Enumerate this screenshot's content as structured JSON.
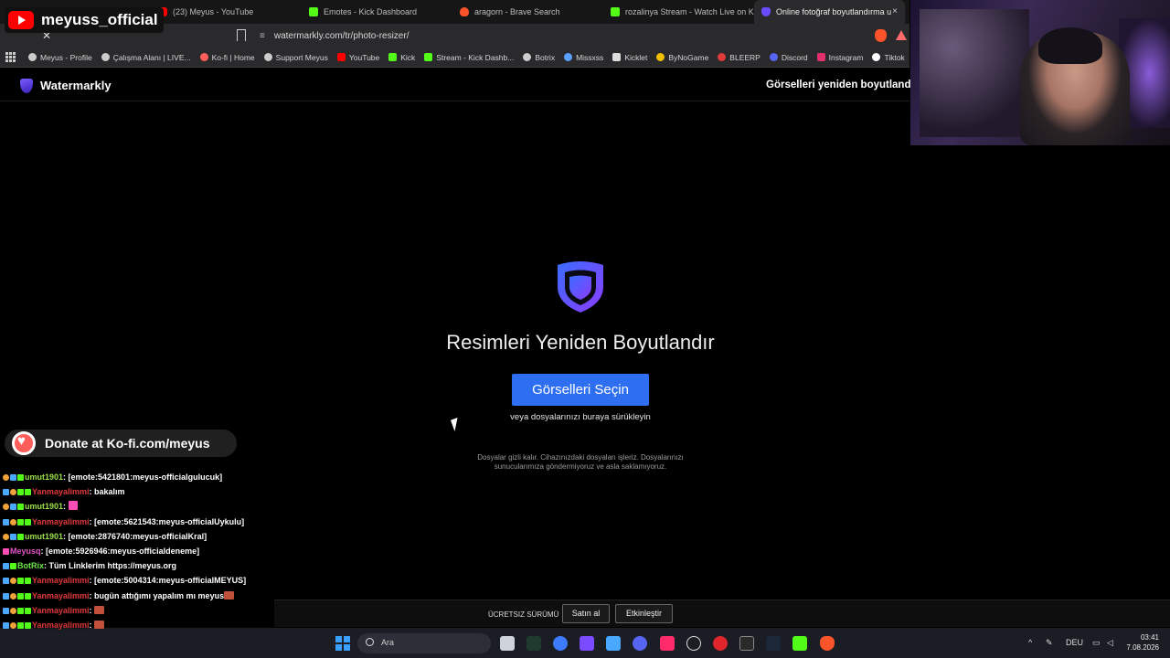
{
  "tabs": [
    {
      "title": "",
      "icon": "kick-icon",
      "active": false
    },
    {
      "title": "(23) Meyus - YouTube",
      "icon": "youtube-icon",
      "active": false
    },
    {
      "title": "Emotes - Kick Dashboard",
      "icon": "kick-icon",
      "active": false
    },
    {
      "title": "aragorn - Brave Search",
      "icon": "brave-icon",
      "active": false
    },
    {
      "title": "rozalinya Stream - Watch Live on Kick",
      "icon": "kick-icon",
      "active": false
    },
    {
      "title": "Online fotoğraf boyutlandırma u",
      "icon": "watermarkly-icon",
      "active": true,
      "close": "×"
    }
  ],
  "address": {
    "url": "watermarkly.com/tr/photo-resizer/",
    "stop": "✕"
  },
  "bookmarks": [
    {
      "label": "Meyus - Profile",
      "color": "#cccccc"
    },
    {
      "label": "Çalışma Alanı | LIVE...",
      "color": "#cccccc"
    },
    {
      "label": "Ko-fi | Home",
      "color": "#ff5e5b"
    },
    {
      "label": "Support Meyus",
      "color": "#cccccc"
    },
    {
      "label": "YouTube",
      "color": "#ff0000"
    },
    {
      "label": "Kick",
      "color": "#53fc18"
    },
    {
      "label": "Stream - Kick Dashb...",
      "color": "#53fc18"
    },
    {
      "label": "Botrix",
      "color": "#cccccc"
    },
    {
      "label": "Missxss",
      "color": "#5aa0ff"
    },
    {
      "label": "Kicklet",
      "color": "#dddddd"
    },
    {
      "label": "ByNoGame",
      "color": "#f0c000"
    },
    {
      "label": "BLEERP",
      "color": "#e03a3a"
    },
    {
      "label": "Discord",
      "color": "#5865f2"
    },
    {
      "label": "Instagram",
      "color": "#e1306c"
    },
    {
      "label": "Tiktok",
      "color": "#ffffff"
    }
  ],
  "site": {
    "logo": "Watermarkly",
    "header_title": "Görselleri yeniden boyutlandır",
    "hero_title": "Resimleri Yeniden Boyutlandır",
    "select_button": "Görselleri Seçin",
    "drop_hint": "veya dosyalarınızı buraya sürükleyin",
    "privacy": "Dosyalar gizli kalır. Cihazınızdaki dosyaları işleriz. Dosyalarınızı sunucularımıza göndermiyoruz ve asla saklamıyoruz."
  },
  "footer": {
    "free_version": "ÜCRETSIZ SÜRÜMÜ",
    "buy": "Satın al",
    "activate": "Etkinleştir"
  },
  "taskbar": {
    "search_placeholder": "Ara",
    "lang": "DEU",
    "time": "03:41",
    "date": "7.08.2026"
  },
  "overlay": {
    "channel": "meyuss_official",
    "kofi": "Donate at Ko-fi.com/meyus",
    "chat": [
      {
        "user": "umut1901",
        "sep": ": ",
        "msg": "[emote:5421801:meyus-officialgulucuk]",
        "color": "lime"
      },
      {
        "user": "Yanmayalimmi",
        "sep": ": ",
        "msg": "bakalım",
        "color": "red"
      },
      {
        "user": "umut1901",
        "sep": ": ",
        "msg": "",
        "color": "lime"
      },
      {
        "user": "Yanmayalimmi",
        "sep": ": ",
        "msg": "[emote:5621543:meyus-officialUykulu]",
        "color": "red"
      },
      {
        "user": "umut1901",
        "sep": ": ",
        "msg": "[emote:2876740:meyus-officialKral]",
        "color": "lime"
      },
      {
        "user": "Meyusq",
        "sep": ": ",
        "msg": "[emote:5926946:meyus-officialdeneme]",
        "color": "pink"
      },
      {
        "user": "BotRix",
        "sep": ": ",
        "msg": "Tüm Linklerim https://meyus.org",
        "color": "green"
      },
      {
        "user": "Yanmayalimmi",
        "sep": ": ",
        "msg": "[emote:5004314:meyus-officialMEYUS]",
        "color": "red"
      },
      {
        "user": "Yanmayalimmi",
        "sep": ": ",
        "msg": "bugün attığımı yapalım mı meyus",
        "color": "red"
      },
      {
        "user": "Yanmayalimmi",
        "sep": ":",
        "msg": "",
        "color": "red"
      },
      {
        "user": "Yanmayalimmi",
        "sep": ":",
        "msg": "",
        "color": "red"
      }
    ]
  },
  "colors": {
    "accent": "#2d6ff0",
    "shield": "#6a3cff",
    "kick": "#53fc18"
  }
}
